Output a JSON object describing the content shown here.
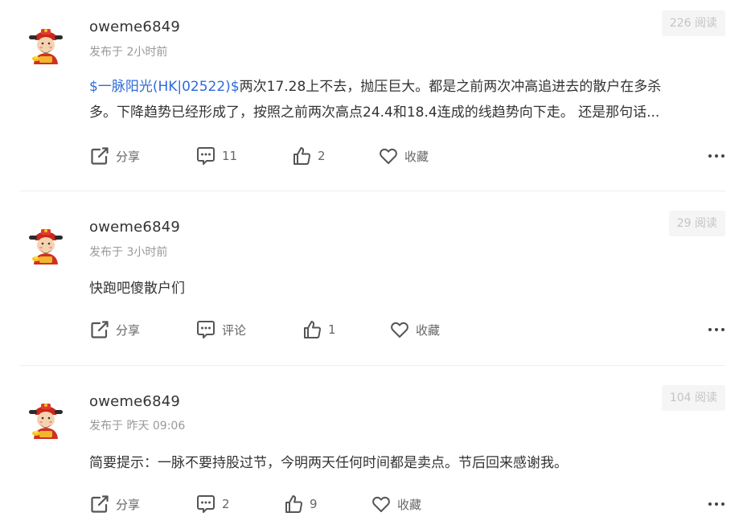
{
  "posts": [
    {
      "username": "oweme6849",
      "meta_prefix": "发布于",
      "time": "2小时前",
      "reads": "226 阅读",
      "stock_link": "$一脉阳光(HK|02522)$",
      "line1": "两次17.28上不去，抛压巨大。都是之前两次冲高追进去的散户在多杀",
      "line2": "多。下降趋势已经形成了，按照之前两次高点24.4和18.4连成的线趋势向下走。 还是那句话...",
      "share_label": "分享",
      "comment_label": "11",
      "like_label": "2",
      "fav_label": "收藏"
    },
    {
      "username": "oweme6849",
      "meta_prefix": "发布于",
      "time": "3小时前",
      "reads": "29 阅读",
      "text": "快跑吧傻散户们",
      "share_label": "分享",
      "comment_label": "评论",
      "like_label": "1",
      "fav_label": "收藏"
    },
    {
      "username": "oweme6849",
      "meta_prefix": "发布于",
      "time": "昨天 09:06",
      "reads": "104 阅读",
      "text": "简要提示：一脉不要持股过节，今明两天任何时间都是卖点。节后回来感谢我。",
      "share_label": "分享",
      "comment_label": "2",
      "like_label": "9",
      "fav_label": "收藏"
    }
  ],
  "icons": {
    "avatar": "caishen-avatar",
    "share": "share-icon",
    "comment": "comment-icon",
    "like": "thumbs-up-icon",
    "favorite": "heart-icon",
    "more": "more-dots-icon"
  },
  "colors": {
    "link": "#2f6bd8",
    "text": "#333333",
    "muted": "#999999",
    "action": "#666666"
  }
}
